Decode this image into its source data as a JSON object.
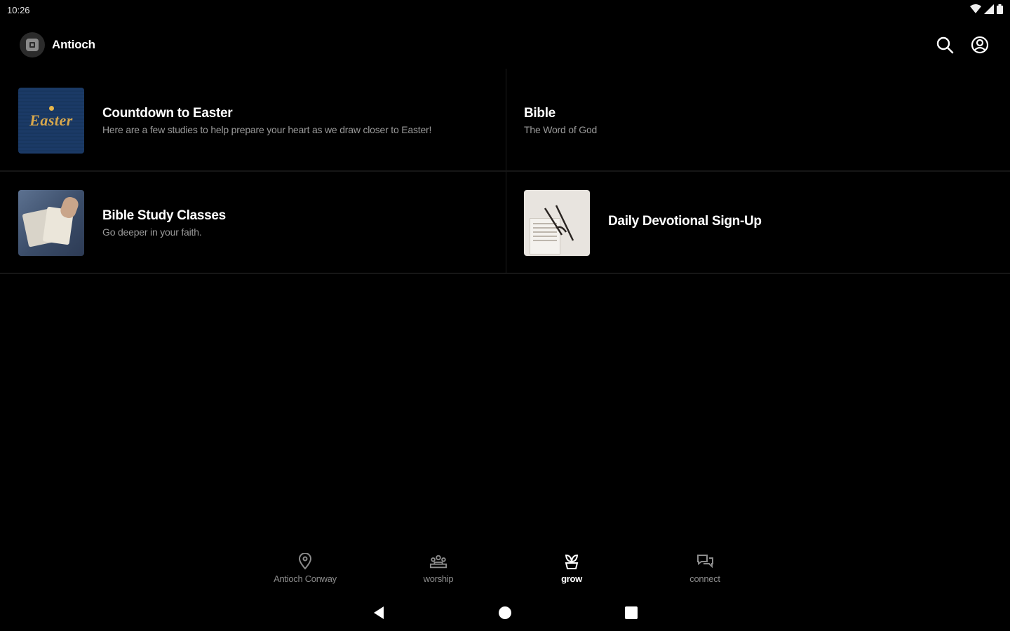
{
  "status_bar": {
    "time": "10:26",
    "icons": [
      "wifi-icon",
      "signal-icon",
      "battery-icon"
    ]
  },
  "app_bar": {
    "title": "Antioch",
    "actions": [
      "search-icon",
      "account-icon"
    ]
  },
  "items": [
    {
      "title": "Countdown to Easter",
      "subtitle": "Here are a few studies to help prepare your heart as we draw closer to Easter!",
      "thumbnail": "easter-image",
      "thumbnail_text": "Easter"
    },
    {
      "title": "Bible",
      "subtitle": "The Word of God",
      "thumbnail": null
    },
    {
      "title": "Bible Study Classes",
      "subtitle": "Go deeper in your faith.",
      "thumbnail": "open-bible-image"
    },
    {
      "title": "Daily Devotional Sign-Up",
      "subtitle": "",
      "thumbnail": "glasses-book-image"
    }
  ],
  "bottom_nav": {
    "items": [
      {
        "label": "Antioch Conway",
        "icon": "location-pin-icon",
        "active": false
      },
      {
        "label": "worship",
        "icon": "people-icon",
        "active": false
      },
      {
        "label": "grow",
        "icon": "grow-icon",
        "active": true
      },
      {
        "label": "connect",
        "icon": "chat-icon",
        "active": false
      }
    ]
  },
  "colors": {
    "background": "#000000",
    "text_primary": "#ffffff",
    "text_secondary": "#9a9a9a",
    "nav_inactive": "#8c8c8c",
    "divider": "#1e1e1e"
  }
}
